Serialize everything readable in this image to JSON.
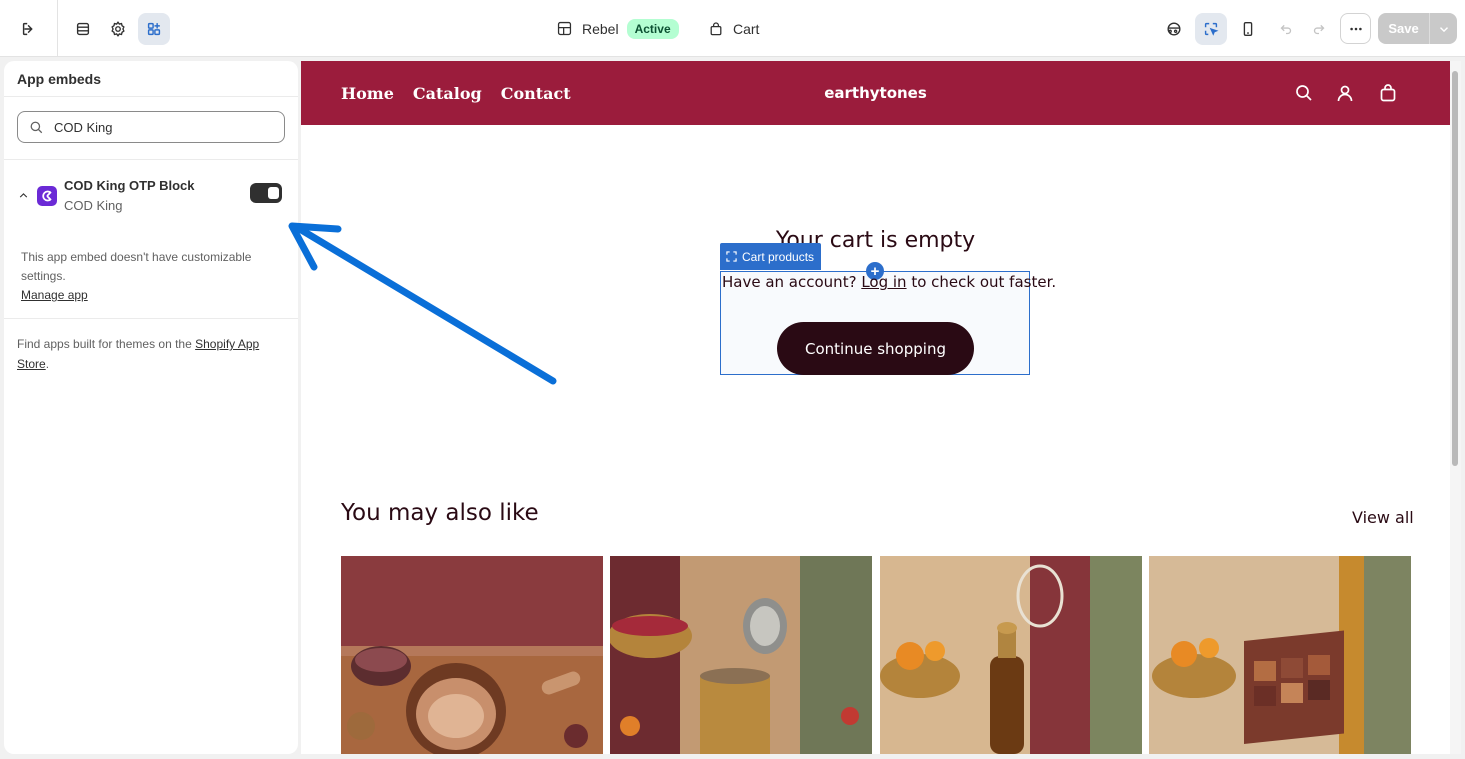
{
  "topbar": {
    "theme_name": "Rebel",
    "theme_status": "Active",
    "template_name": "Cart",
    "save_label": "Save"
  },
  "sidebar": {
    "title": "App embeds",
    "search_value": "COD King",
    "app": {
      "name": "COD King OTP Block",
      "vendor": "COD King",
      "enabled": true
    },
    "note": "This app embed doesn't have customizable settings.",
    "manage_link": "Manage app",
    "find_prefix": "Find apps built for themes on the",
    "find_link": "Shopify App Store",
    "find_suffix": "."
  },
  "store": {
    "nav": [
      "Home",
      "Catalog",
      "Contact"
    ],
    "brand": "earthytones",
    "header_color": "#9b1c3c",
    "cart_title": "Your cart is empty",
    "editor_section_label": "Cart products",
    "account_prefix": "Have an account?",
    "login_link": "Log in",
    "account_suffix": "to check out faster.",
    "continue_button": "Continue shopping",
    "also_like": "You may also like",
    "view_all": "View all"
  },
  "annotation": {
    "arrow_color": "#0a6fd8"
  }
}
